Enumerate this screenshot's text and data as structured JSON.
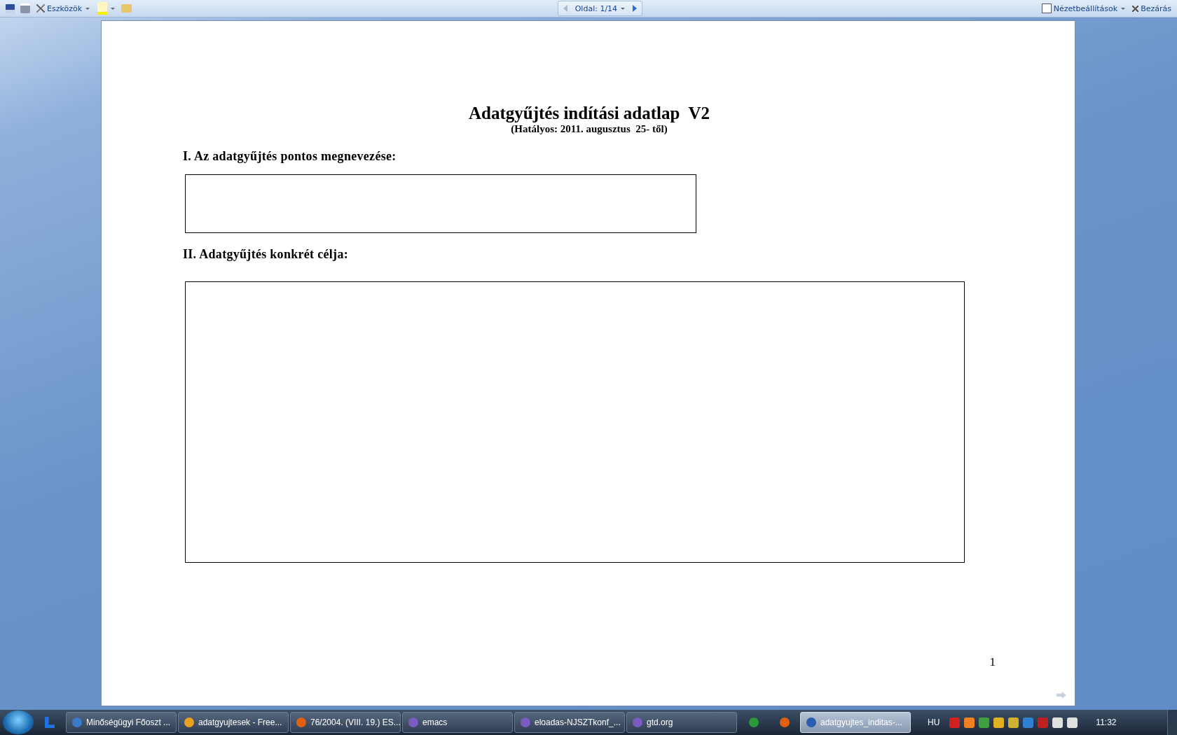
{
  "toolbar": {
    "tools_label": "Eszközök",
    "page_indicator": "Oldal: 1/14",
    "view_options": "Nézetbeállítások",
    "close": "Bezárás"
  },
  "document": {
    "title": "Adatgyűjtés indítási adatlap  V2",
    "subtitle": "(Hatályos: 2011. augusztus  25- től)",
    "sections": [
      {
        "heading": "I. Az adatgyűjtés pontos megnevezése:",
        "kind": "single_line"
      },
      {
        "heading": "II. Adatgyűjtés konkrét célja:",
        "kind": "multi_line"
      }
    ],
    "page_number": "1"
  },
  "taskbar": {
    "items": [
      {
        "kind": "task",
        "label": "Minőségügyi Főoszt ...",
        "selected": false
      },
      {
        "kind": "task",
        "label": "adatgyujtesek - Free...",
        "selected": false
      },
      {
        "kind": "task",
        "label": "76/2004. (VIII. 19.) ES...",
        "selected": false
      },
      {
        "kind": "task",
        "label": "emacs",
        "selected": false
      },
      {
        "kind": "task",
        "label": "eloadas-NJSZTkonf_...",
        "selected": false
      },
      {
        "kind": "task",
        "label": "gtd.org",
        "selected": false
      },
      {
        "kind": "launcher"
      },
      {
        "kind": "launcher"
      },
      {
        "kind": "task",
        "label": "adatgyujtes_inditas-...",
        "selected": true
      }
    ],
    "language": "HU",
    "clock": "11:32"
  }
}
